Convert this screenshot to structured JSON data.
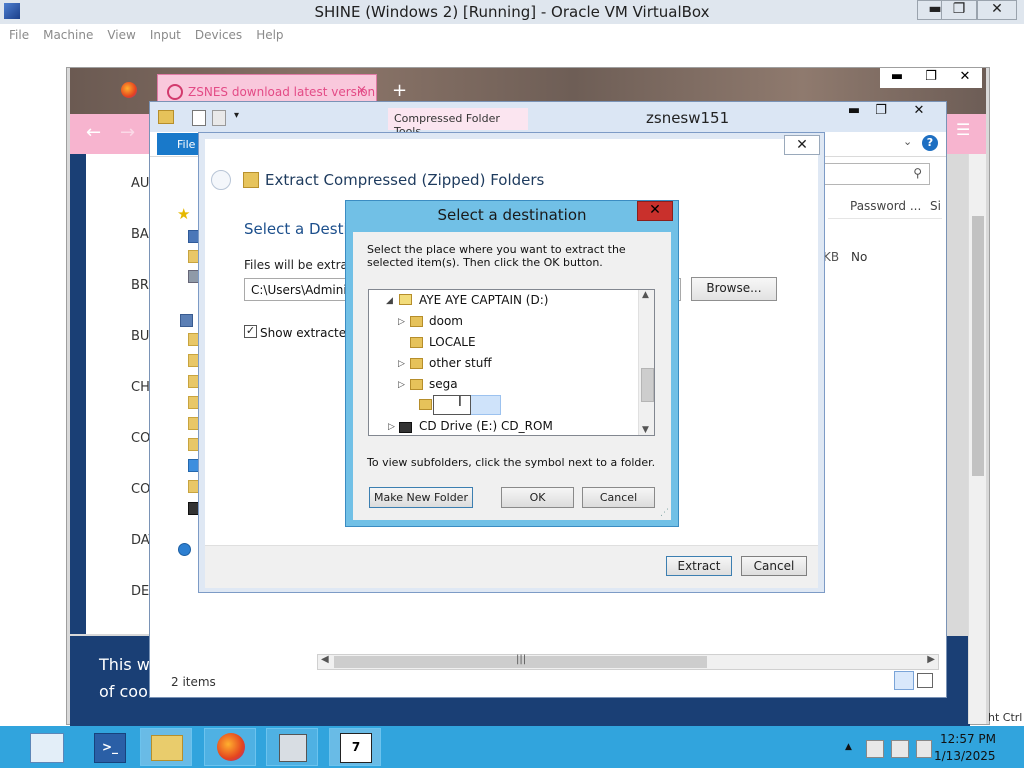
{
  "host": {
    "title": "SHINE (Windows 2) [Running] - Oracle VM VirtualBox",
    "menu": [
      "File",
      "Machine",
      "View",
      "Input",
      "Devices",
      "Help"
    ],
    "controls": {
      "minimize": "▬",
      "restore": "❐",
      "close": "✕"
    }
  },
  "browser": {
    "tab_label": "ZSNES download latest version",
    "tab_close": "×",
    "new_tab": "+",
    "back": "←",
    "forward": "→",
    "nav_labels": [
      "AU",
      "BA",
      "BR",
      "BU",
      "CH",
      "CO",
      "CO",
      "DAT",
      "DE"
    ],
    "banner_line1": "This we",
    "banner_line2": "of cook",
    "right_hint": "ht Ctrl"
  },
  "explorer": {
    "title": "zsnesw151",
    "contextual_tab": "Compressed Folder Tools",
    "file_tab": "File",
    "help": "?",
    "ribbon_chevron": "⌄",
    "search_icon": "⚲",
    "column_password": "Password ...",
    "column_size": "Si",
    "cell_kb": "KB",
    "cell_no": "No",
    "status_items": "2 items"
  },
  "wizard": {
    "title": "Extract Compressed (Zipped) Folders",
    "close": "✕",
    "heading": "Select a Destin",
    "files_label": "Files will be extracte",
    "path_value": "C:\\Users\\Administ",
    "browse_label": "Browse...",
    "show_checked": "✓",
    "show_label": "Show extracted f",
    "extract_label": "Extract",
    "cancel_label": "Cancel"
  },
  "dialog": {
    "title": "Select a destination",
    "close": "✕",
    "description": "Select the place where you want to extract the selected item(s).  Then click the OK button.",
    "tree": {
      "root": "AYE AYE CAPTAIN (D:)",
      "children": [
        "doom",
        "LOCALE",
        "other stuff",
        "sega"
      ],
      "new_folder_value": "",
      "next_drive": "CD Drive (E:) CD_ROM"
    },
    "hint": "To view subfolders, click the symbol next to a folder.",
    "make_new_folder": "Make New Folder",
    "ok": "OK",
    "cancel": "Cancel"
  },
  "taskbar": {
    "time": "12:57 PM",
    "date": "1/13/2025",
    "tray_arrow": "▲"
  }
}
